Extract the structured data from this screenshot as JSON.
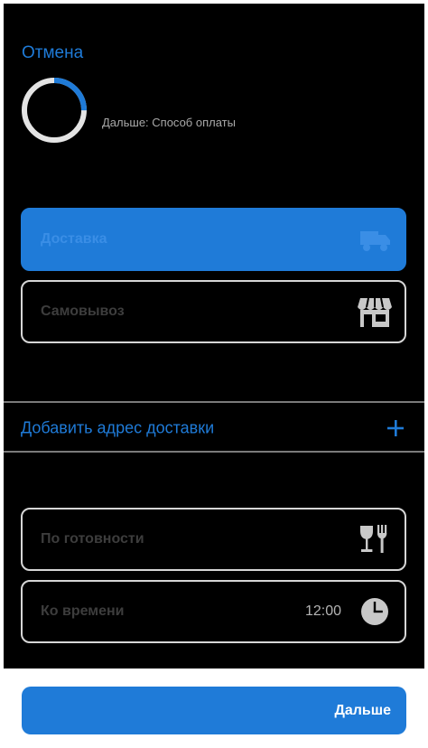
{
  "header": {
    "cancel_label": "Отмена",
    "next_step_label": "Дальше: Способ оплаты",
    "progress_fraction": 0.25
  },
  "delivery_options": [
    {
      "label": "Доставка",
      "icon": "truck-icon",
      "selected": true
    },
    {
      "label": "Самовывоз",
      "icon": "store-icon",
      "selected": false
    }
  ],
  "address": {
    "add_label": "Добавить адрес доставки",
    "icon": "plus-icon"
  },
  "time_options": [
    {
      "label": "По готовности",
      "icon": "wine-fork-icon"
    },
    {
      "label": "Ко времени",
      "value": "12:00",
      "icon": "clock-icon"
    }
  ],
  "footer": {
    "next_label": "Дальше"
  },
  "colors": {
    "accent": "#1f7bd8",
    "background": "#000000",
    "border": "#d6d6d6"
  }
}
